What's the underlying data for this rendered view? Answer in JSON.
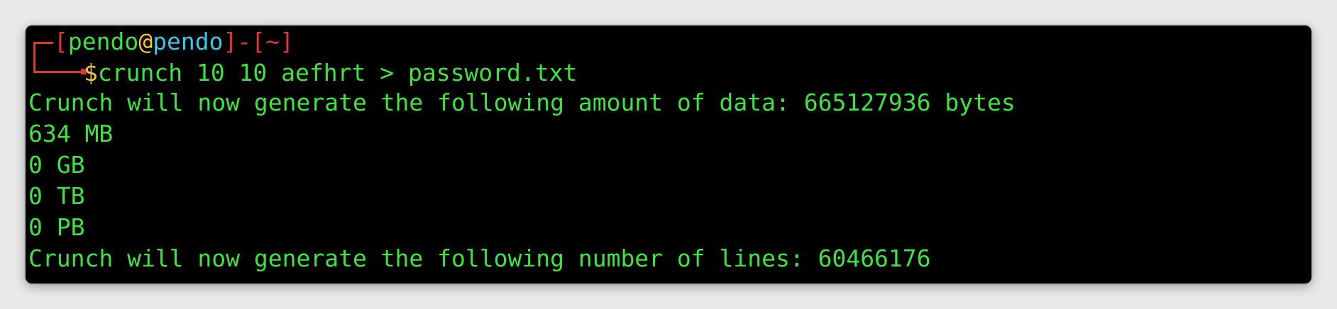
{
  "prompt": {
    "open_bracket": "[",
    "user": "pendo",
    "at": "@",
    "host": "pendo",
    "close_bracket": "]",
    "dash": "-",
    "dir_open": "[",
    "dir": "~",
    "dir_close": "]",
    "dollar": "$",
    "command": "crunch 10 10 aefhrt > password.txt"
  },
  "output": [
    "Crunch will now generate the following amount of data: 665127936 bytes",
    "634 MB",
    "0 GB",
    "0 TB",
    "0 PB",
    "Crunch will now generate the following number of lines: 60466176"
  ],
  "colors": {
    "background": "#000000",
    "output_green": "#3ee43e",
    "prompt_red": "#e0372d",
    "at_yellow": "#f2c531",
    "host_cyan": "#3ac6e6"
  }
}
